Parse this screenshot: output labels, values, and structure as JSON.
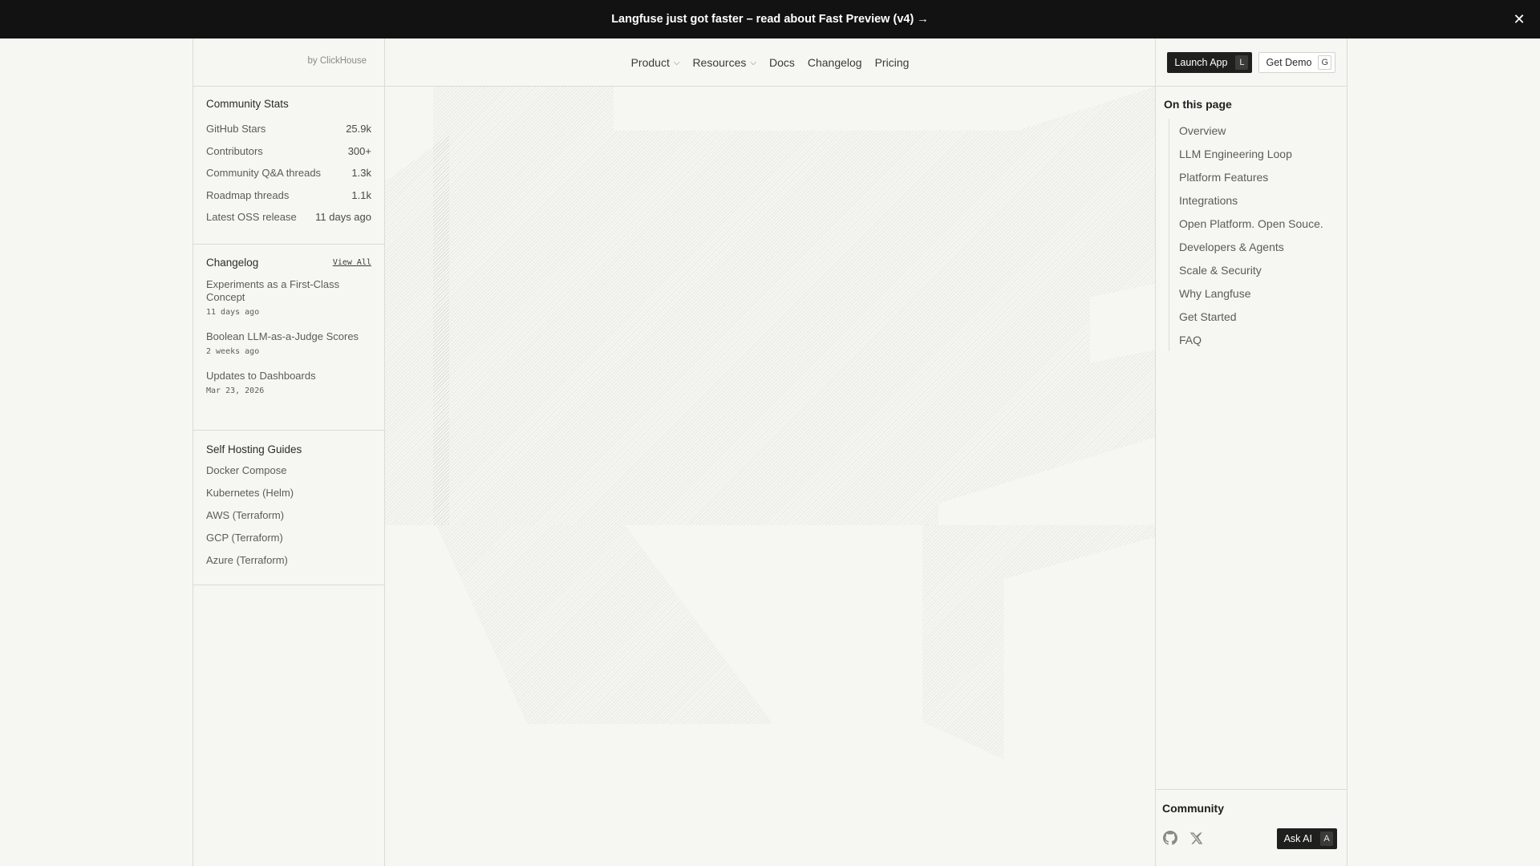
{
  "announcement": {
    "text": "Langfuse just got faster – read about Fast Preview (v4) →",
    "close_icon": "close-icon"
  },
  "brand": {
    "byline": "by ClickHouse"
  },
  "nav": {
    "items": [
      {
        "label": "Product",
        "has_dropdown": true
      },
      {
        "label": "Resources",
        "has_dropdown": true
      },
      {
        "label": "Docs",
        "has_dropdown": false
      },
      {
        "label": "Changelog",
        "has_dropdown": false
      },
      {
        "label": "Pricing",
        "has_dropdown": false
      }
    ]
  },
  "actions": {
    "launch_label": "Launch App",
    "launch_key": "L",
    "demo_label": "Get Demo",
    "demo_key": "G"
  },
  "community_stats": {
    "title": "Community Stats",
    "rows": [
      {
        "label": "GitHub Stars",
        "value": "25.9k"
      },
      {
        "label": "Contributors",
        "value": "300+"
      },
      {
        "label": "Community Q&A threads",
        "value": "1.3k"
      },
      {
        "label": "Roadmap threads",
        "value": "1.1k"
      },
      {
        "label": "Latest OSS release",
        "value": "11 days ago"
      }
    ]
  },
  "changelog": {
    "title": "Changelog",
    "view_all": "View All",
    "entries": [
      {
        "title": "Experiments as a First-Class Concept",
        "date": "11 days ago"
      },
      {
        "title": "Boolean LLM-as-a-Judge Scores",
        "date": "2 weeks ago"
      },
      {
        "title": "Updates to Dashboards",
        "date": "Mar 23, 2026"
      }
    ]
  },
  "self_hosting": {
    "title": "Self Hosting Guides",
    "items": [
      "Docker Compose",
      "Kubernetes (Helm)",
      "AWS (Terraform)",
      "GCP (Terraform)",
      "Azure (Terraform)"
    ]
  },
  "toc": {
    "title": "On this page",
    "items": [
      "Overview",
      "LLM Engineering Loop",
      "Platform Features",
      "Integrations",
      "Open Platform. Open Souce.",
      "Developers & Agents",
      "Scale & Security",
      "Why Langfuse",
      "Get Started",
      "FAQ"
    ]
  },
  "community": {
    "title": "Community",
    "icons": [
      "github-icon",
      "x-icon"
    ],
    "ask_ai_label": "Ask AI",
    "ask_ai_key": "A"
  },
  "colors": {
    "banner_bg": "#121212",
    "page_bg": "#f6f6f2",
    "border": "#dcdcd6",
    "dark_button": "#1f1f1d"
  }
}
